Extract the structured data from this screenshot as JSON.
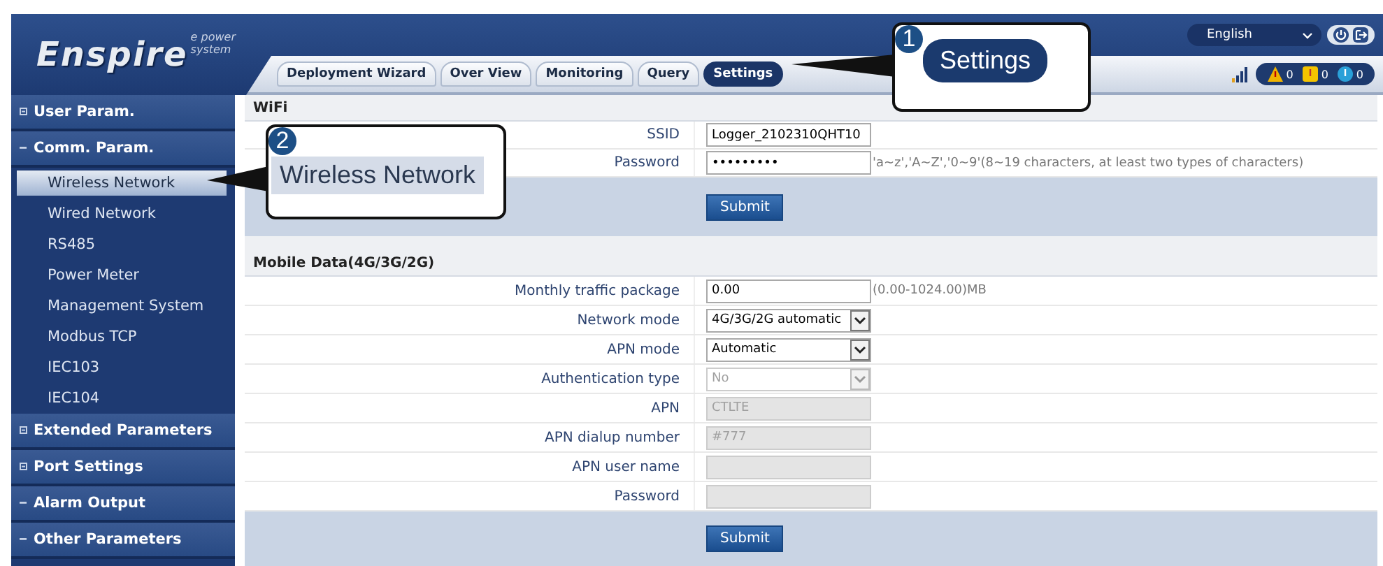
{
  "logo": {
    "title": "Enspire",
    "tagline": "e power system"
  },
  "language": {
    "value": "English"
  },
  "tabs": [
    {
      "label": "Deployment Wizard",
      "selected": false
    },
    {
      "label": "Over View",
      "selected": false
    },
    {
      "label": "Monitoring",
      "selected": false
    },
    {
      "label": "Query",
      "selected": false
    },
    {
      "label": "Settings",
      "selected": true
    }
  ],
  "alarm_counts": [
    {
      "kind": "major",
      "count": "0"
    },
    {
      "kind": "minor",
      "count": "0"
    },
    {
      "kind": "info",
      "count": "0"
    }
  ],
  "sidebar": {
    "items": [
      {
        "label": "User Param.",
        "expanded": false,
        "selected": false
      },
      {
        "label": "Comm. Param.",
        "expanded": true,
        "selected": false,
        "children": [
          {
            "label": "Wireless Network",
            "selected": true
          },
          {
            "label": "Wired Network",
            "selected": false
          },
          {
            "label": "RS485",
            "selected": false
          },
          {
            "label": "Power Meter",
            "selected": false
          },
          {
            "label": "Management System",
            "selected": false
          },
          {
            "label": "Modbus TCP",
            "selected": false
          },
          {
            "label": "IEC103",
            "selected": false
          },
          {
            "label": "IEC104",
            "selected": false
          }
        ]
      },
      {
        "label": "Extended Parameters",
        "expanded": false,
        "selected": false
      },
      {
        "label": "Port Settings",
        "expanded": false,
        "selected": false
      },
      {
        "label": "Alarm Output",
        "expanded": true,
        "selected": false
      },
      {
        "label": "Other Parameters",
        "expanded": true,
        "selected": false
      }
    ]
  },
  "sections": [
    {
      "title": "WiFi",
      "button": "Submit",
      "fields": [
        {
          "label": "SSID",
          "kind": "text",
          "value": "Logger_2102310QHT10",
          "disabled": false
        },
        {
          "label": "Password",
          "kind": "password",
          "value": "•••••••••",
          "hint": "'a~z','A~Z','0~9'(8~19 characters, at least two types of characters)",
          "disabled": false
        }
      ]
    },
    {
      "title": "Mobile Data(4G/3G/2G)",
      "button": "Submit",
      "fields": [
        {
          "label": "Monthly traffic package",
          "kind": "text",
          "value": "0.00",
          "hint": "(0.00-1024.00)MB",
          "disabled": false
        },
        {
          "label": "Network mode",
          "kind": "select",
          "value": "4G/3G/2G automatic",
          "disabled": false
        },
        {
          "label": "APN mode",
          "kind": "select",
          "value": "Automatic",
          "disabled": false
        },
        {
          "label": "Authentication type",
          "kind": "select",
          "value": "No",
          "disabled": true
        },
        {
          "label": "APN",
          "kind": "text",
          "value": "CTLTE",
          "disabled": true
        },
        {
          "label": "APN dialup number",
          "kind": "text",
          "value": "#777",
          "disabled": true
        },
        {
          "label": "APN user name",
          "kind": "text",
          "disabled": true
        },
        {
          "label": "Password",
          "kind": "text",
          "disabled": true
        }
      ]
    }
  ],
  "callouts": [
    {
      "number": "1",
      "text": "Settings",
      "kind": "pill"
    },
    {
      "number": "2",
      "text": "Wireless Network",
      "kind": "plain"
    }
  ]
}
